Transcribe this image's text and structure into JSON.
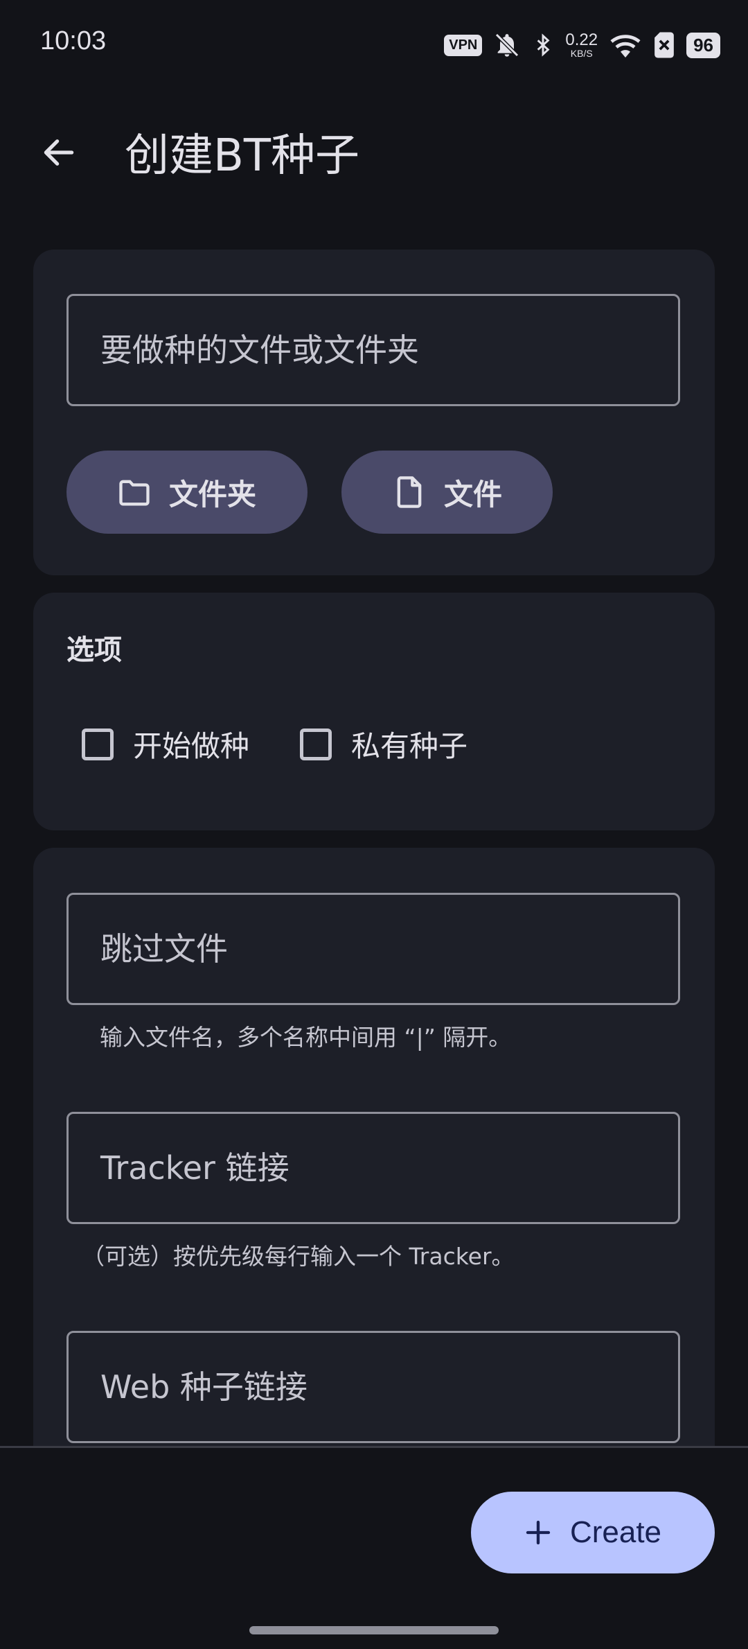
{
  "status_bar": {
    "time": "10:03",
    "vpn": "VPN",
    "speed_value": "0.22",
    "speed_unit": "KB/S",
    "battery": "96",
    "icons": [
      "vpn-icon",
      "bell-muted-icon",
      "bluetooth-icon",
      "wifi-icon",
      "sim-off-icon",
      "battery-icon"
    ]
  },
  "app_bar": {
    "title": "创建BT种子"
  },
  "source_card": {
    "path_placeholder": "要做种的文件或文件夹",
    "folder_button": "文件夹",
    "file_button": "文件"
  },
  "options_card": {
    "title": "选项",
    "start_seeding": "开始做种",
    "private_torrent": "私有种子",
    "start_seeding_checked": false,
    "private_torrent_checked": false
  },
  "advanced_card": {
    "skip_files_placeholder": "跳过文件",
    "skip_files_helper": "输入文件名，多个名称中间用 “|” 隔开。",
    "tracker_placeholder": "Tracker 链接",
    "tracker_helper": "（可选）按优先级每行输入一个 Tracker。",
    "web_seed_placeholder": "Web 种子链接"
  },
  "fab": {
    "label": "Create"
  },
  "colors": {
    "background": "#121318",
    "card": "#1d1f28",
    "tonal_button": "#4a4a69",
    "fab": "#b8c4ff",
    "fab_text": "#182154"
  }
}
